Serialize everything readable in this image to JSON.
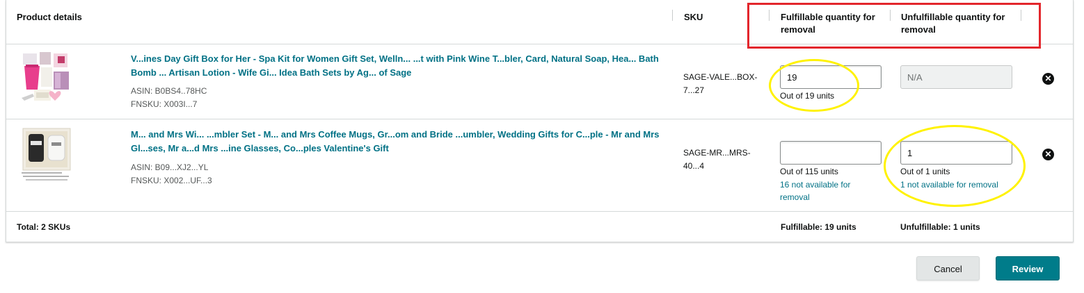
{
  "header": {
    "product_details": "Product details",
    "sku": "SKU",
    "fulfillable_qty": "Fulfillable quantity for removal",
    "unfulfillable_qty": "Unfulfillable quantity for removal"
  },
  "rows": [
    {
      "title": "V...ines Day Gift Box for Her - Spa Kit for Women Gift Set, Welln... ...t with Pink Wine T...bler, Card, Natural Soap, Hea... Bath Bomb ... Artisan Lotion - Wife Gi... Idea Bath Sets by Ag... of Sage",
      "asin": "ASIN: B0BS4..78HC",
      "fnsku": "FNSKU: X003I...7",
      "sku": "SAGE-VALE...BOX-7...27",
      "fulfillable_value": "19",
      "fulfillable_note": "Out of 19 units",
      "unfulfillable_value": "N/A",
      "unfulfillable_note": ""
    },
    {
      "title": "M... and Mrs Wi... ...mbler Set - M... and Mrs Coffee Mugs, Gr...om and Bride ...umbler, Wedding Gifts for C...ple - Mr and Mrs Gl...ses, Mr a...d Mrs ...ine Glasses, Co...ples Valentine's Gift",
      "asin": "ASIN: B09...XJ2...YL",
      "fnsku": "FNSKU: X002...UF...3",
      "sku": "SAGE-MR...MRS-40...4",
      "fulfillable_value": "",
      "fulfillable_note": "Out of 115 units",
      "fulfillable_link": "16 not available for removal",
      "unfulfillable_value": "1",
      "unfulfillable_note": "Out of 1 units",
      "unfulfillable_link": "1 not available for removal"
    }
  ],
  "footer": {
    "total": "Total: 2 SKUs",
    "fulfillable": "Fulfillable: 19 units",
    "unfulfillable": "Unfulfillable: 1 units"
  },
  "actions": {
    "cancel": "Cancel",
    "review": "Review"
  },
  "colors": {
    "link": "#007185",
    "primary_button": "#007c8a",
    "highlight_red": "#e3262c",
    "highlight_yellow": "#fff200"
  }
}
